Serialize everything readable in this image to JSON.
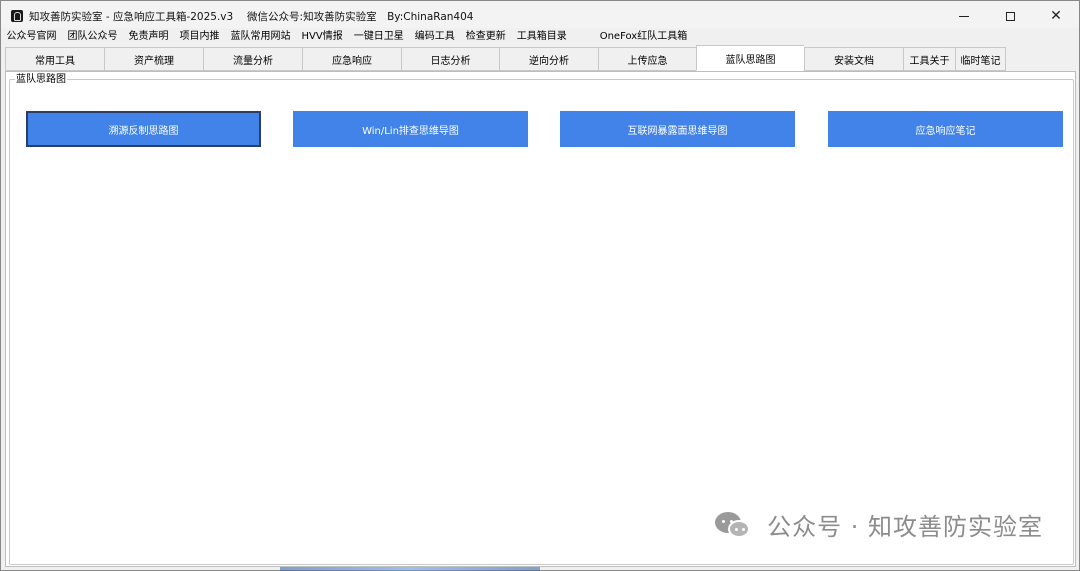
{
  "window": {
    "title": "知攻善防实验室 - 应急响应工具箱-2025.v3　 微信公众号:知攻善防实验室　By:ChinaRan404",
    "controls": {
      "minimize": "minimize-icon",
      "maximize": "maximize-icon",
      "close": "close-icon"
    }
  },
  "menu": [
    "公众号官网",
    "团队公众号",
    "免责声明",
    "项目内推",
    "蓝队常用网站",
    "HVV情报",
    "一键日卫星",
    "编码工具",
    "检查更新",
    "工具箱目录",
    "OneFox红队工具箱"
  ],
  "tabs": [
    {
      "label": "常用工具"
    },
    {
      "label": "资产梳理"
    },
    {
      "label": "流量分析"
    },
    {
      "label": "应急响应"
    },
    {
      "label": "日志分析"
    },
    {
      "label": "逆向分析"
    },
    {
      "label": "上传应急"
    },
    {
      "label": "蓝队思路图",
      "active": true
    },
    {
      "label": "安装文档"
    },
    {
      "label": "工具关于"
    },
    {
      "label": "临时笔记"
    }
  ],
  "group": {
    "legend": "蓝队思路图",
    "buttons": [
      {
        "label": "溯源反制思路图",
        "focused": true
      },
      {
        "label": "Win/Lin排查思维导图"
      },
      {
        "label": "互联网暴露面思维导图"
      },
      {
        "label": "应急响应笔记"
      }
    ]
  },
  "watermark": {
    "text": "公众号 · 知攻善防实验室",
    "icon": "wechat-icon"
  },
  "colors": {
    "accent": "#4183e9",
    "focus_border": "#2c3e66"
  }
}
